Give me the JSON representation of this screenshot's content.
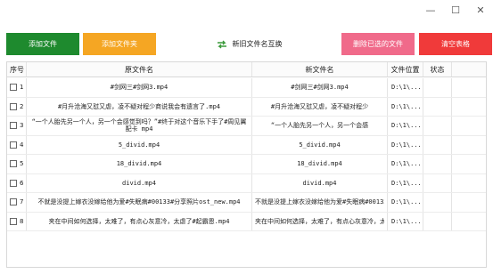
{
  "window": {
    "minimize_glyph": "—",
    "maximize_glyph": "☐",
    "close_glyph": "✕"
  },
  "toolbar": {
    "add_file_label": "添加文件",
    "add_folder_label": "添加文件夹",
    "rename_label": "新旧文件名互换",
    "rename_icon": "swap-icon",
    "delete_selected_label": "删除已选的文件",
    "clear_table_label": "清空表格",
    "colors": {
      "add_file": "#1e8a2e",
      "add_folder": "#f5a623",
      "delete_selected": "#f06a8a",
      "clear_table": "#f03a3a"
    }
  },
  "table": {
    "headers": {
      "index": "序号",
      "original_name": "原文件名",
      "new_name": "新文件名",
      "location": "文件位置",
      "status": "状态"
    },
    "rows": [
      {
        "index": "1",
        "original": "#剑网三#剑网3.mp4",
        "new": "#剑网三#剑网3.mp4",
        "location": "D:\\1\\...",
        "status": ""
      },
      {
        "index": "2",
        "original": "#月升沧海又怼又虐，凌不疑对程少商说我会有遗言了.mp4",
        "new": "#月升沧海又怼又虐，凌不疑对程少",
        "location": "D:\\1\\...",
        "status": ""
      },
      {
        "index": "3",
        "original": "“一个人胎先另一个人，另一个会感觉到吗？”#终于对这个音乐下手了#周见翼配卡 mp4",
        "new": "“一个人胎先另一个人，另一个会感",
        "location": "D:\\1\\...",
        "status": ""
      },
      {
        "index": "4",
        "original": "5_divid.mp4",
        "new": "5_divid.mp4",
        "location": "D:\\1\\...",
        "status": ""
      },
      {
        "index": "5",
        "original": "18_divid.mp4",
        "new": "18_divid.mp4",
        "location": "D:\\1\\...",
        "status": ""
      },
      {
        "index": "6",
        "original": "divid.mp4",
        "new": "divid.mp4",
        "location": "D:\\1\\...",
        "status": ""
      },
      {
        "index": "7",
        "original": "不就是没提上嫁衣没嫁给他为爱#失眠病#00133#分享照片ost_new.mp4",
        "new": "不就是没提上嫁衣没嫁给他为爱#失眠病#00133#分享照片ost_new.mp4",
        "location": "D:\\1\\...",
        "status": ""
      },
      {
        "index": "8",
        "original": "夹在中间如何选择，太难了，有点心灰意冷，太虐了#起霸恩.mp4",
        "new": "夹在中间如何选择，太难了，有点心灰意冷，太虐了#起霸恩.mp4",
        "location": "D:\\1\\...",
        "status": ""
      }
    ]
  }
}
